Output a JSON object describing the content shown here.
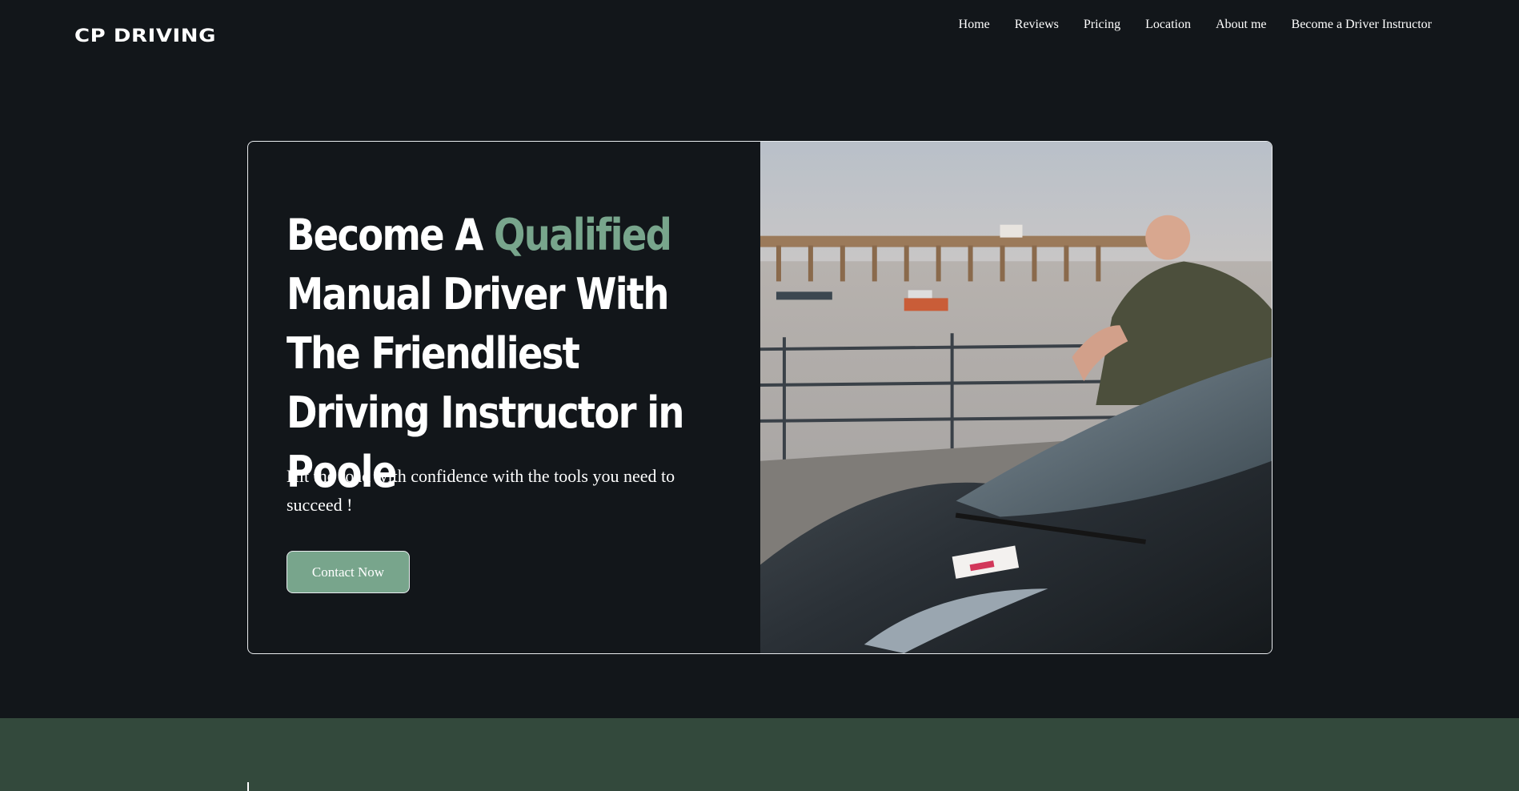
{
  "brand": {
    "logo_text": "CP DRIVING"
  },
  "nav": {
    "items": [
      {
        "label": "Home"
      },
      {
        "label": "Reviews"
      },
      {
        "label": "Pricing"
      },
      {
        "label": "Location"
      },
      {
        "label": "About me"
      },
      {
        "label": "Become a Driver Instructor"
      }
    ]
  },
  "hero": {
    "headline_part1": "Become A ",
    "headline_accent": "Qualified",
    "headline_part2": "Manual Driver With The Friendliest Driving Instructor in Poole",
    "subtext": "Hit the road with confidence with the tools you need to succeed !",
    "cta_label": "Contact Now",
    "image_alt": "Driving instructor leaning on a dark car with L-plate by the pier in Swanage",
    "image_icon": "photo-instructor-car"
  },
  "colors": {
    "background": "#12161a",
    "accent": "#78a58c",
    "band": "#33493c",
    "border": "#e9ecef"
  }
}
